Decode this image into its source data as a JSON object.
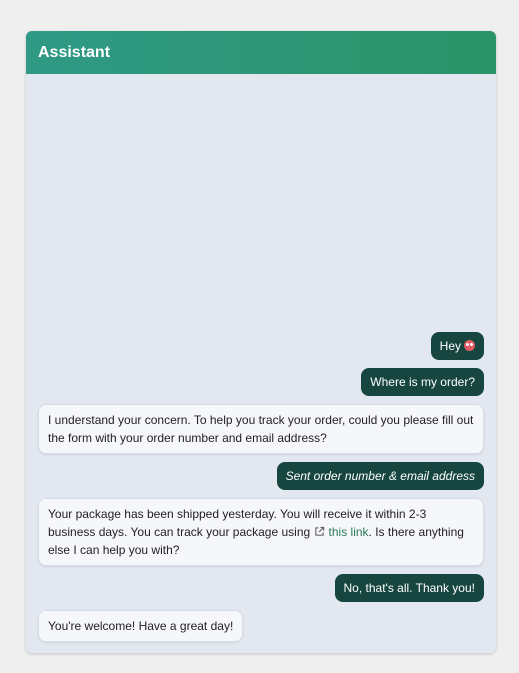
{
  "header": {
    "title": "Assistant"
  },
  "messages": [
    {
      "role": "user",
      "text": "Hey"
    },
    {
      "role": "user",
      "text": "Where is my order?"
    },
    {
      "role": "assistant",
      "text": "I understand your concern. To help you track your order, could you please fill out the form with your order number and email address?"
    },
    {
      "role": "user",
      "text": "Sent order number & email address"
    },
    {
      "role": "assistant",
      "text_before": "Your package has been shipped yesterday. You will receive it within 2-3 business days. You can track your package using",
      "link_label": "this link",
      "text_after": ". Is there anything else I can help you with?"
    },
    {
      "role": "user",
      "text": "No, that's all. Thank you!"
    },
    {
      "role": "assistant",
      "text": "You're welcome! Have a great day!"
    }
  ],
  "colors": {
    "header_start": "#2f9985",
    "header_end": "#2b9468",
    "user_bubble": "#16463f",
    "assistant_bubble": "#f5f7fb",
    "link": "#2a7a57"
  },
  "icons": [
    "shocked-face-emoji-icon",
    "external-link-icon"
  ]
}
